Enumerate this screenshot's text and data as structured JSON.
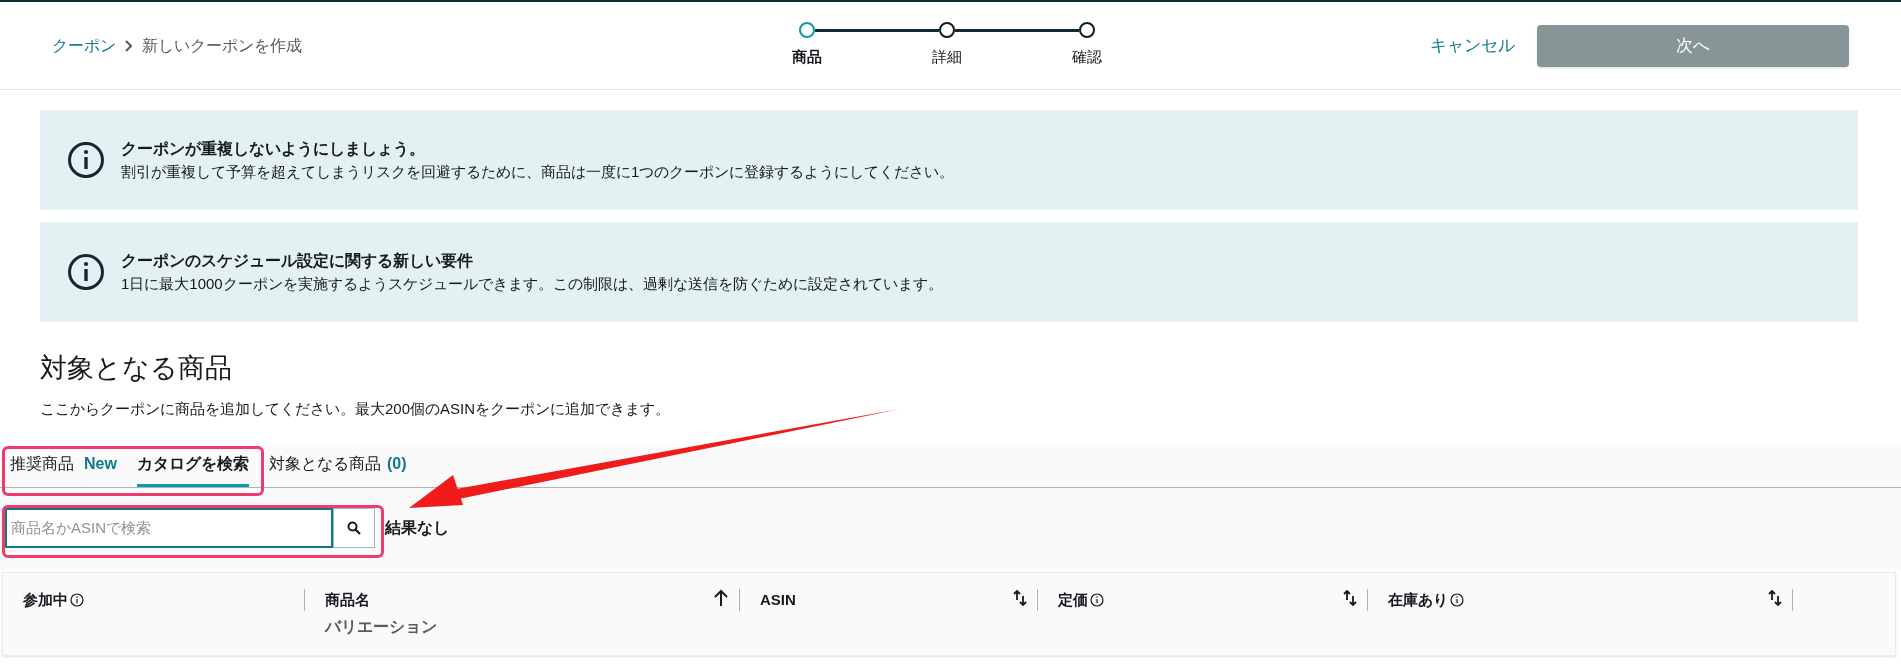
{
  "breadcrumb": {
    "parent": "クーポン",
    "current": "新しいクーポンを作成"
  },
  "steps": [
    {
      "label": "商品",
      "selected": true
    },
    {
      "label": "詳細",
      "selected": false
    },
    {
      "label": "確認",
      "selected": false
    }
  ],
  "actions": {
    "cancel": "キャンセル",
    "next": {
      "label": "次へ",
      "disabled": true
    }
  },
  "alerts": [
    {
      "title": "クーポンが重複しないようにしましょう。",
      "body": "割引が重複して予算を超えてしまうリスクを回避するために、商品は一度に1つのクーポンに登録するようにしてください。"
    },
    {
      "title": "クーポンのスケジュール設定に関する新しい要件",
      "body": "1日に最大1000クーポンを実施するようスケジュールできます。この制限は、過剰な送信を防ぐために設定されています。"
    }
  ],
  "section": {
    "title": "対象となる商品",
    "description": "ここからクーポンに商品を追加してください。最大200個のASINをクーポンに追加できます。"
  },
  "tabs": [
    {
      "label": "推奨商品",
      "badge": "New",
      "selected": false
    },
    {
      "label": "カタログを検索",
      "selected": true
    },
    {
      "label": "対象となる商品",
      "count": "(0)",
      "selected": false
    }
  ],
  "search": {
    "placeholder": "商品名かASINで検索",
    "result": "結果なし"
  },
  "table": {
    "columns": [
      {
        "label": "参加中",
        "info": true,
        "kind": "plain"
      },
      {
        "label": "商品名",
        "sublabel": "バリエーション",
        "info": false,
        "kind": "ascending"
      },
      {
        "label": "ASIN",
        "info": false,
        "kind": "sortable"
      },
      {
        "label": "定価",
        "info": true,
        "kind": "sortable"
      },
      {
        "label": "在庫あり",
        "info": true,
        "kind": "sortable"
      }
    ]
  }
}
